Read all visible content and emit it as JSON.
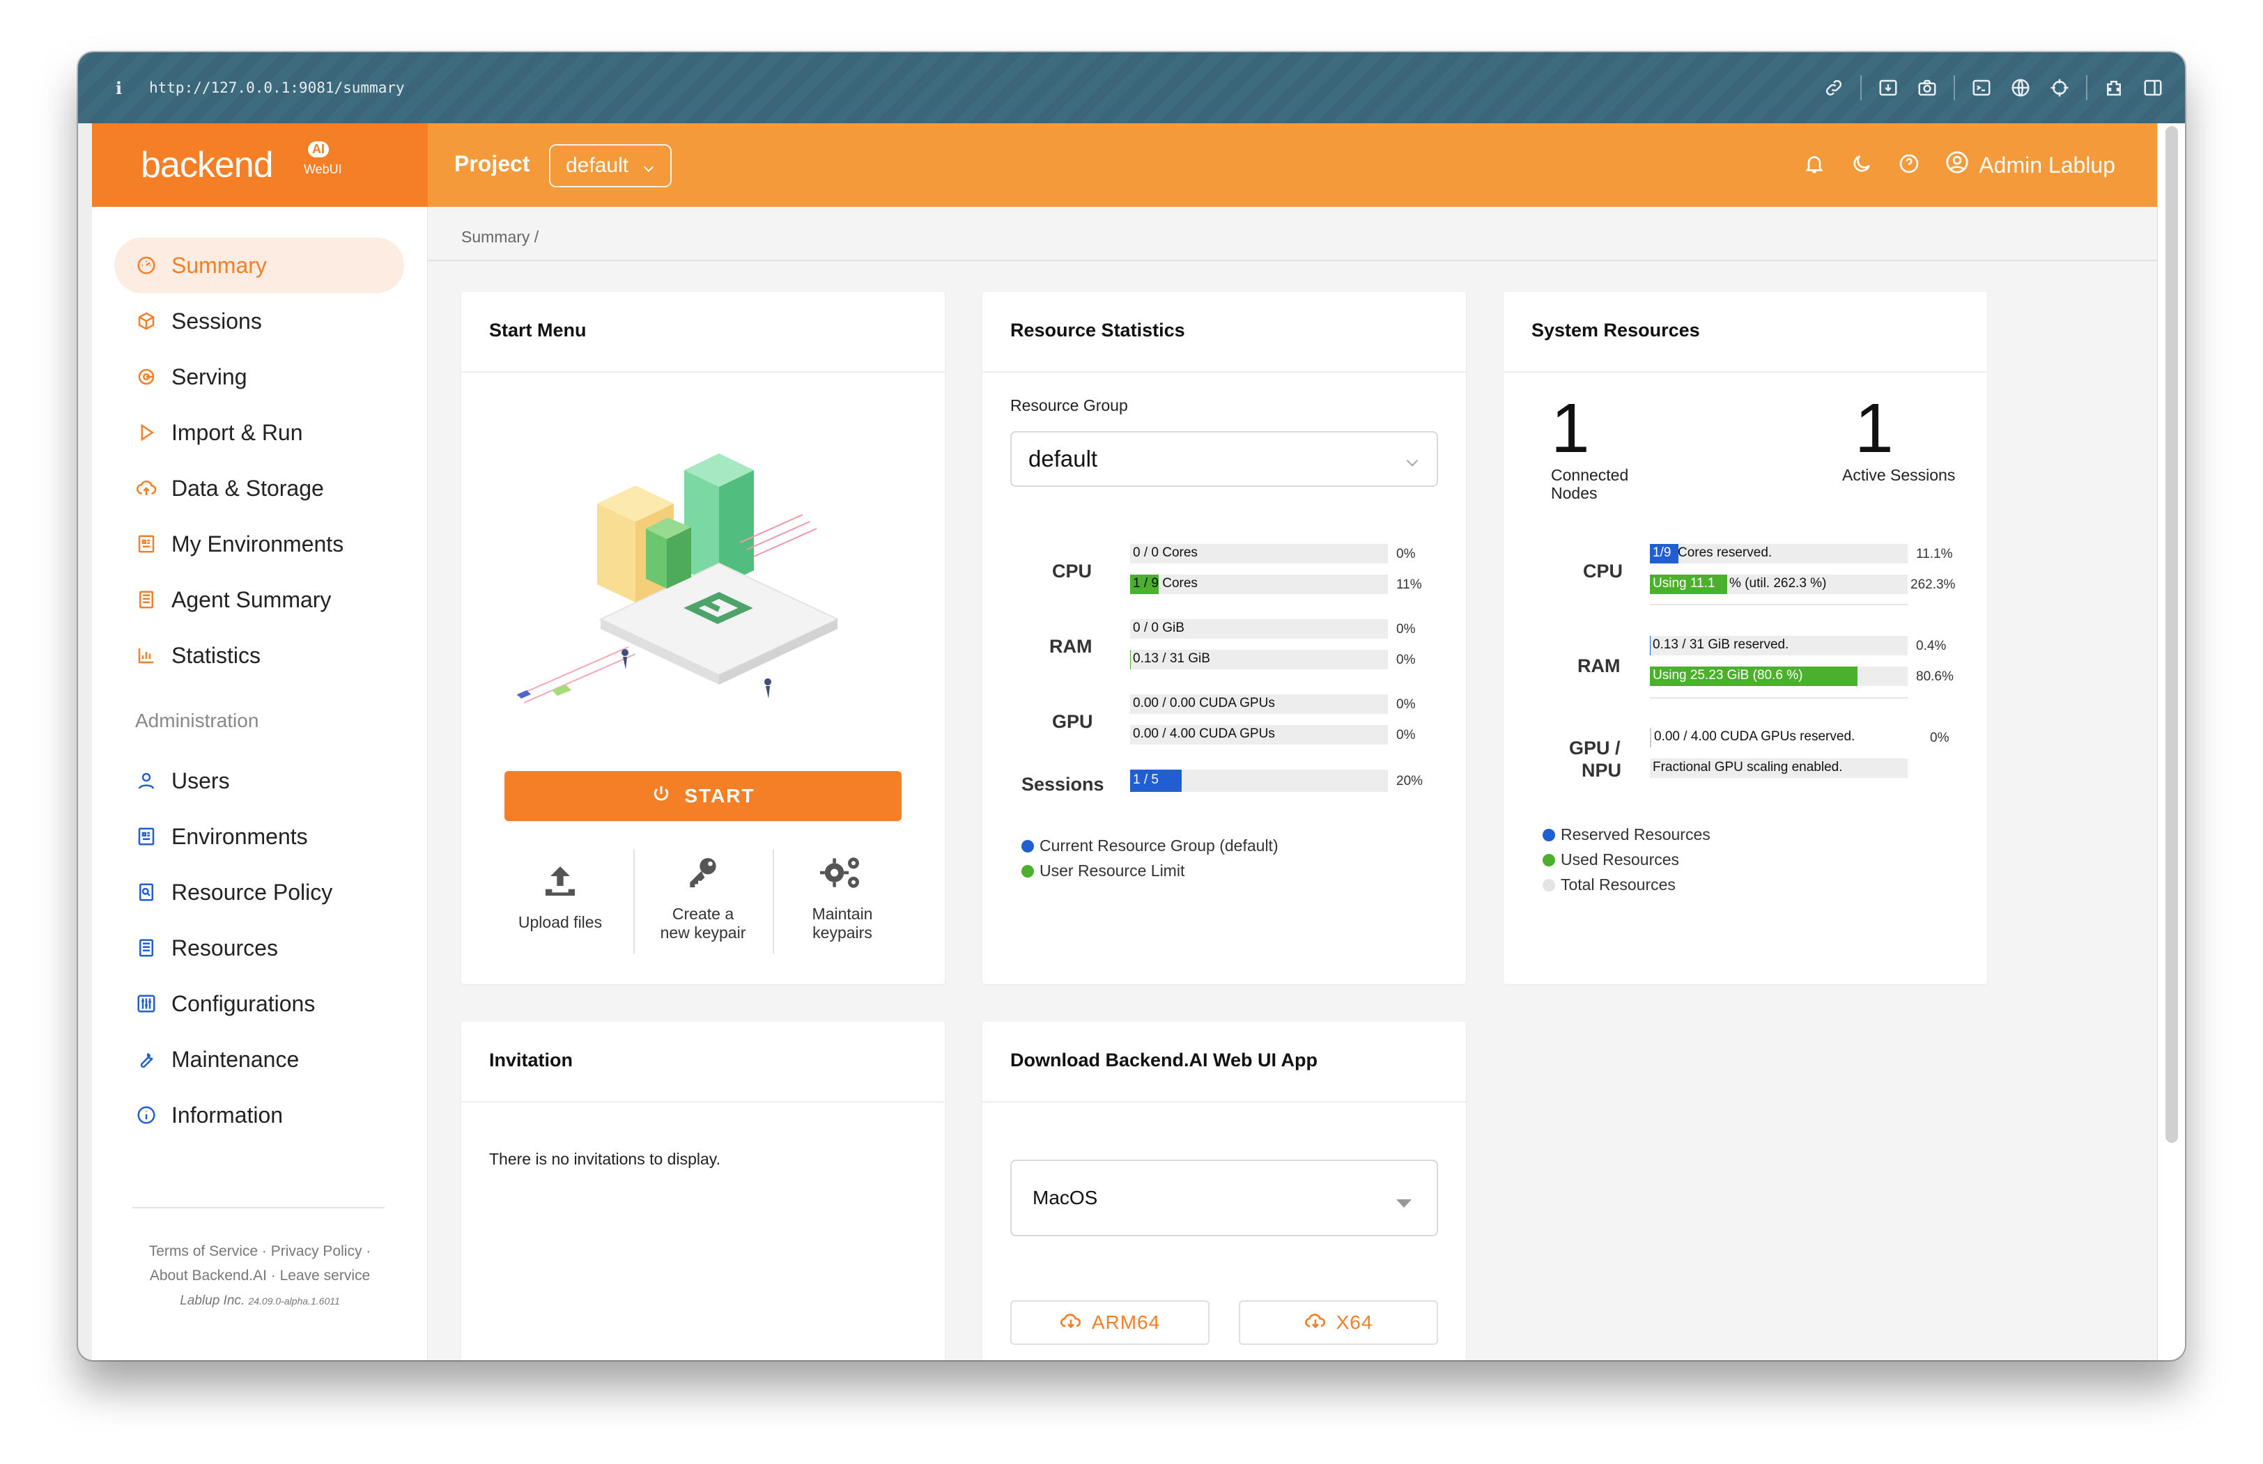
{
  "browser": {
    "url": "http://127.0.0.1:9081/summary",
    "info_icon": "i"
  },
  "header": {
    "logo_text": "backend",
    "logo_badge": "AI",
    "logo_sub": "WebUI",
    "project_label": "Project",
    "project_value": "default",
    "user_name": "Admin Lablup"
  },
  "sidebar": {
    "items": [
      {
        "label": "Summary",
        "icon": "summary-icon"
      },
      {
        "label": "Sessions",
        "icon": "sessions-icon"
      },
      {
        "label": "Serving",
        "icon": "serving-icon"
      },
      {
        "label": "Import & Run",
        "icon": "import-run-icon"
      },
      {
        "label": "Data & Storage",
        "icon": "data-storage-icon"
      },
      {
        "label": "My Environments",
        "icon": "my-environments-icon"
      },
      {
        "label": "Agent Summary",
        "icon": "agent-summary-icon"
      },
      {
        "label": "Statistics",
        "icon": "statistics-icon"
      }
    ],
    "admin_title": "Administration",
    "admin_items": [
      {
        "label": "Users",
        "icon": "users-icon"
      },
      {
        "label": "Environments",
        "icon": "environments-icon"
      },
      {
        "label": "Resource Policy",
        "icon": "resource-policy-icon"
      },
      {
        "label": "Resources",
        "icon": "resources-icon"
      },
      {
        "label": "Configurations",
        "icon": "configurations-icon"
      },
      {
        "label": "Maintenance",
        "icon": "maintenance-icon"
      },
      {
        "label": "Information",
        "icon": "information-icon"
      }
    ],
    "footer": {
      "terms": "Terms of Service",
      "privacy": "Privacy Policy",
      "about": "About Backend.AI",
      "leave": "Leave service",
      "company": "Lablup Inc.",
      "version": "24.09.0-alpha.1.6011"
    }
  },
  "breadcrumb": "Summary  /",
  "start_menu": {
    "title": "Start Menu",
    "start_label": "START",
    "actions": [
      {
        "line1": "Upload files",
        "line2": ""
      },
      {
        "line1": "Create a",
        "line2": "new keypair"
      },
      {
        "line1": "Maintain",
        "line2": "keypairs"
      }
    ]
  },
  "resource_stats": {
    "title": "Resource Statistics",
    "group_label": "Resource Group",
    "group_value": "default",
    "rows": [
      {
        "label": "CPU",
        "bars": [
          {
            "text": "0 / 0 Cores",
            "pct": "0%",
            "fill": 0
          },
          {
            "text": "1 / 9 Cores",
            "pct": "11%",
            "fill": 0.11
          }
        ]
      },
      {
        "label": "RAM",
        "bars": [
          {
            "text": "0 / 0 GiB",
            "pct": "0%",
            "fill": 0
          },
          {
            "text": "0.13 / 31 GiB",
            "pct": "0%",
            "fill": 0.004
          }
        ]
      },
      {
        "label": "GPU",
        "bars": [
          {
            "text": "0.00 / 0.00 CUDA GPUs",
            "pct": "0%",
            "fill": 0
          },
          {
            "text": "0.00 / 4.00 CUDA GPUs",
            "pct": "0%",
            "fill": 0
          }
        ]
      }
    ],
    "sessions_label": "Sessions",
    "sessions_bar": {
      "text": "1 / 5",
      "pct": "20%",
      "fill": 0.2
    },
    "legend": [
      "Current Resource Group (default)",
      "User Resource Limit"
    ]
  },
  "system_resources": {
    "title": "System Resources",
    "connected_nodes": "1",
    "connected_nodes_label_1": "Connected",
    "connected_nodes_label_2": "Nodes",
    "active_sessions": "1",
    "active_sessions_label": "Active Sessions",
    "cpu_label": "CPU",
    "cpu_bar1": {
      "badge": "1/9",
      "text": "Cores reserved.",
      "pct": "11.1%",
      "fill": 0.111
    },
    "cpu_bar2": {
      "badge": "Using 11.1",
      "text": "% (util. 262.3 %)",
      "pct": "262.3%",
      "fill": 0.3
    },
    "ram_label": "RAM",
    "ram_bar1": {
      "text": "0.13 / 31 GiB reserved.",
      "pct": "0.4%",
      "fill": 0.004
    },
    "ram_bar2": {
      "text": "Using 25.23 GiB (80.6 %)",
      "pct": "80.6%",
      "fill": 0.806
    },
    "gpu_label_1": "GPU /",
    "gpu_label_2": "NPU",
    "gpu_bar1": {
      "text": "0.00 / 4.00 CUDA GPUs reserved.",
      "pct": "0%",
      "fill": 0
    },
    "gpu_bar2": {
      "text": "Fractional GPU scaling enabled."
    },
    "legend": [
      "Reserved Resources",
      "Used Resources",
      "Total Resources"
    ]
  },
  "invitation": {
    "title": "Invitation",
    "empty": "There is no invitations to display."
  },
  "download": {
    "title": "Download Backend.AI Web UI App",
    "os_value": "MacOS",
    "btn_arm": "ARM64",
    "btn_x64": "X64"
  },
  "colors": {
    "accent": "#f57f26",
    "blue": "#1f5fd1",
    "green": "#4caf2d",
    "grey": "#ededed"
  }
}
